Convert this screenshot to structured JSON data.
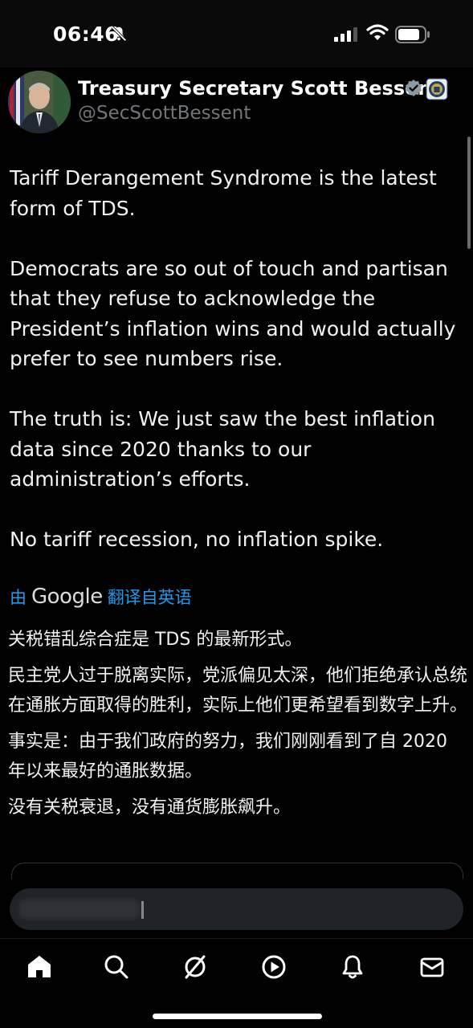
{
  "status_bar": {
    "time": "06:46",
    "icons": [
      "mute-icon",
      "signal-icon",
      "wifi-icon",
      "battery-icon"
    ]
  },
  "tweet": {
    "author_name": "Treasury Secretary Scott Bessent",
    "handle": "@SecScottBessent",
    "paragraphs": [
      "Tariff Derangement Syndrome is the latest form of TDS.",
      "Democrats are so out of touch and partisan that they refuse to acknowledge the President’s inflation wins and would actually prefer to see numbers rise.",
      "The truth is: We just saw the best inflation data since 2020 thanks to our administration’s efforts.",
      "No tariff recession, no inflation spike."
    ]
  },
  "translation": {
    "prefix": "由",
    "provider": "Google",
    "suffix": "翻译自英语",
    "paragraphs": [
      "关税错乱综合症是 TDS 的最新形式。",
      "民主党人过于脱离实际，党派偏见太深，他们拒绝承认总统在通胀方面取得的胜利，实际上他们更希望看到数字上升。",
      "事实是：由于我们政府的努力，我们刚刚看到了自 2020 年以来最好的通胀数据。",
      "没有关税衰退，没有通货膨胀飙升。"
    ]
  },
  "colors": {
    "background": "#000000",
    "text": "#f2f2f2",
    "muted": "#71767b",
    "accent": "#1d9bf0",
    "verified": "#8b98a5"
  },
  "tab_bar": {
    "items": [
      "home-icon",
      "search-icon",
      "grok-icon",
      "video-icon",
      "notifications-icon",
      "messages-icon"
    ]
  }
}
